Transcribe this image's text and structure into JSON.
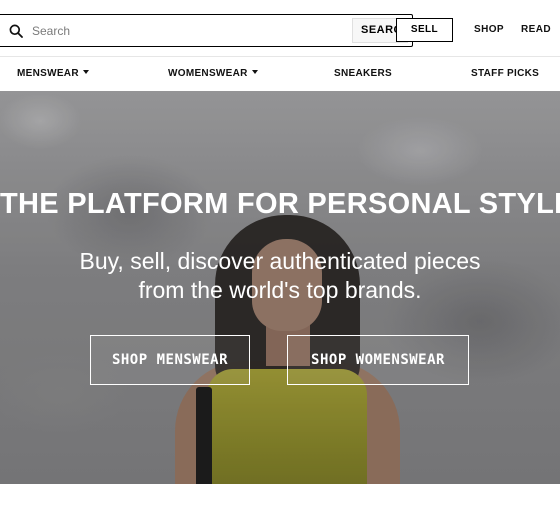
{
  "header": {
    "search": {
      "placeholder": "Search",
      "button_label": "SEARCH"
    },
    "sell_label": "SELL",
    "links": {
      "shop": "SHOP",
      "read": "READ"
    }
  },
  "category_nav": {
    "items": [
      {
        "label": "MENSWEAR",
        "has_dropdown": true
      },
      {
        "label": "WOMENSWEAR",
        "has_dropdown": true
      },
      {
        "label": "SNEAKERS",
        "has_dropdown": false
      },
      {
        "label": "STAFF PICKS",
        "has_dropdown": false
      }
    ]
  },
  "hero": {
    "title": "THE PLATFORM FOR PERSONAL STYLE",
    "subtitle_line1": "Buy, sell, discover authenticated pieces",
    "subtitle_line2": "from the world's top brands.",
    "buttons": {
      "menswear": "SHOP MENSWEAR",
      "womenswear": "SHOP WOMENSWEAR"
    }
  },
  "icons": {
    "search": "search-icon",
    "dropdown": "caret-down-icon"
  }
}
